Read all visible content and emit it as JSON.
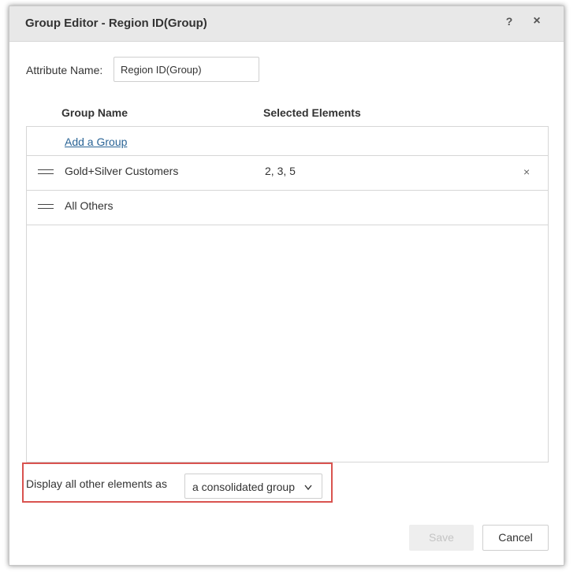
{
  "dialog": {
    "title": "Group Editor - Region ID(Group)",
    "help_label": "?",
    "close_label": "×"
  },
  "attribute": {
    "label": "Attribute Name:",
    "value": "Region ID(Group)"
  },
  "grid": {
    "columns": [
      "Group Name",
      "Selected Elements"
    ],
    "add_group_label": "Add a Group",
    "rows": [
      {
        "name": "Gold+Silver Customers",
        "elements": "2, 3, 5",
        "remove_label": "×"
      },
      {
        "name": "All Others",
        "elements": ""
      }
    ]
  },
  "display_other": {
    "label": "Display all other elements as",
    "selected": "a consolidated group"
  },
  "footer": {
    "save_label": "Save",
    "cancel_label": "Cancel"
  },
  "colors": {
    "highlight": "#d9534f",
    "link": "#2a6496"
  }
}
